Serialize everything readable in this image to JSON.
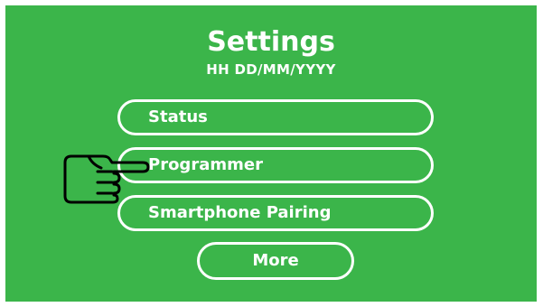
{
  "screen": {
    "background_color": "#3bb54a",
    "text_color": "#ffffff",
    "title": "Settings",
    "datetime": "HH DD/MM/YYYY"
  },
  "menu": {
    "items": [
      {
        "label": "Status"
      },
      {
        "label": "Programmer"
      },
      {
        "label": "Smartphone Pairing"
      }
    ],
    "more_label": "More"
  },
  "pointer": {
    "icon": "pointing-hand-icon",
    "points_to": "Programmer"
  }
}
